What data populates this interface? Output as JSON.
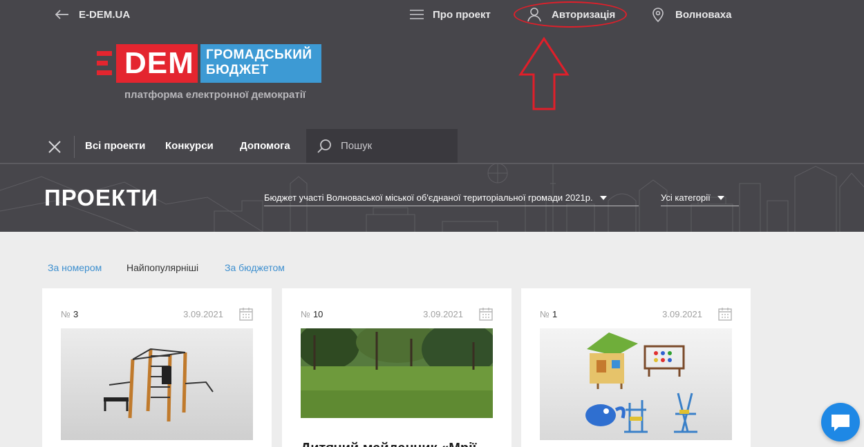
{
  "topbar": {
    "back_label": "E-DEM.UA",
    "about_label": "Про проект",
    "auth_label": "Авторизація",
    "city_label": "Волноваха"
  },
  "logo": {
    "dem": "DEM",
    "budget_line1": "ГРОМАДСЬКИЙ",
    "budget_line2": "БЮДЖЕТ",
    "subtitle": "платформа електронної демократії"
  },
  "nav": {
    "items": [
      "Всі проекти",
      "Конкурси",
      "Допомога"
    ],
    "search_placeholder": "Пошук"
  },
  "hero": {
    "title": "ПРОЕКТИ",
    "budget_select": "Бюджет участі Волноваської міської об'єднаної територіальної громади 2021р.",
    "category_select": "Усі категорії"
  },
  "sort": {
    "by_number": "За номером",
    "most_popular": "Найпопулярніші",
    "by_budget": "За бюджетом"
  },
  "cards": [
    {
      "num_prefix": "№",
      "number": "3",
      "date": "3.09.2021",
      "title": ""
    },
    {
      "num_prefix": "№",
      "number": "10",
      "date": "3.09.2021",
      "title": "Дитячий майданчик «Мрії"
    },
    {
      "num_prefix": "№",
      "number": "1",
      "date": "3.09.2021",
      "title": ""
    }
  ],
  "colors": {
    "header_bg": "#47464b",
    "brand_red": "#e4252f",
    "brand_blue": "#3d9ad4",
    "link_blue": "#3d8fcf",
    "annotation_red": "#e01f2a",
    "chat_blue": "#1e88e5"
  },
  "icons": {
    "back": "arrow-left-icon",
    "about": "menu-lines-icon",
    "auth": "user-icon",
    "city": "map-pin-icon",
    "close": "close-icon",
    "search": "search-icon",
    "calendar": "calendar-icon",
    "chat": "chat-bubble-icon"
  }
}
